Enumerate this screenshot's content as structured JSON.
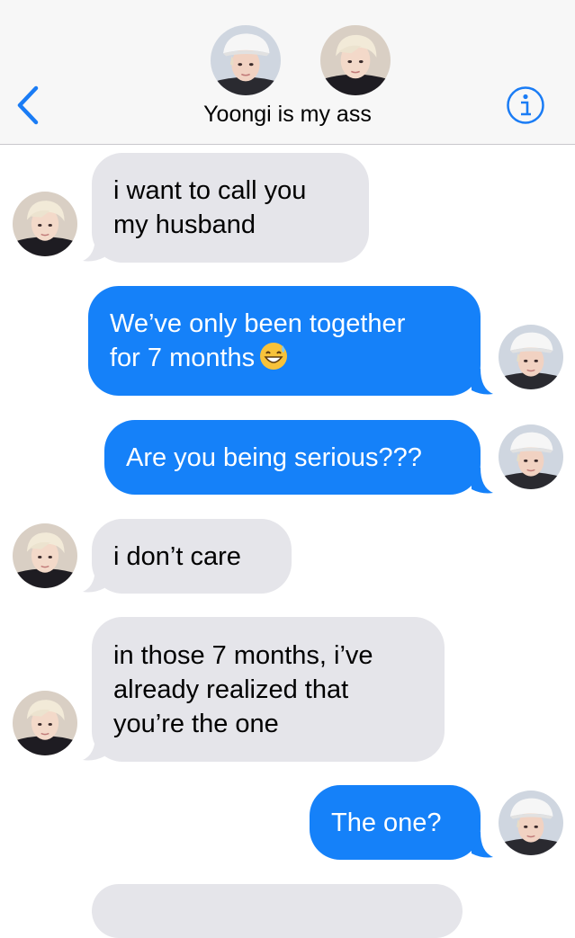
{
  "header": {
    "title": "Yoongi is my ass",
    "back_icon": "chevron-left-icon",
    "info_icon": "info-circle-icon",
    "accent_color": "#1a7cf5"
  },
  "colors": {
    "incoming_bubble": "#e5e5ea",
    "outgoing_bubble": "#1581f9"
  },
  "messages": [
    {
      "direction": "incoming",
      "lines": [
        "i want to call you",
        "my husband"
      ]
    },
    {
      "direction": "outgoing",
      "lines": [
        "We’ve only been together",
        "for 7 months"
      ],
      "emoji": "sweat-smile-emoji"
    },
    {
      "direction": "outgoing",
      "lines": [
        "Are you being serious???"
      ]
    },
    {
      "direction": "incoming",
      "lines": [
        "i don’t care"
      ]
    },
    {
      "direction": "incoming",
      "lines": [
        "in those 7 months, i’ve",
        "already realized that",
        "you’re the one"
      ]
    },
    {
      "direction": "outgoing",
      "lines": [
        "The one?"
      ]
    }
  ]
}
